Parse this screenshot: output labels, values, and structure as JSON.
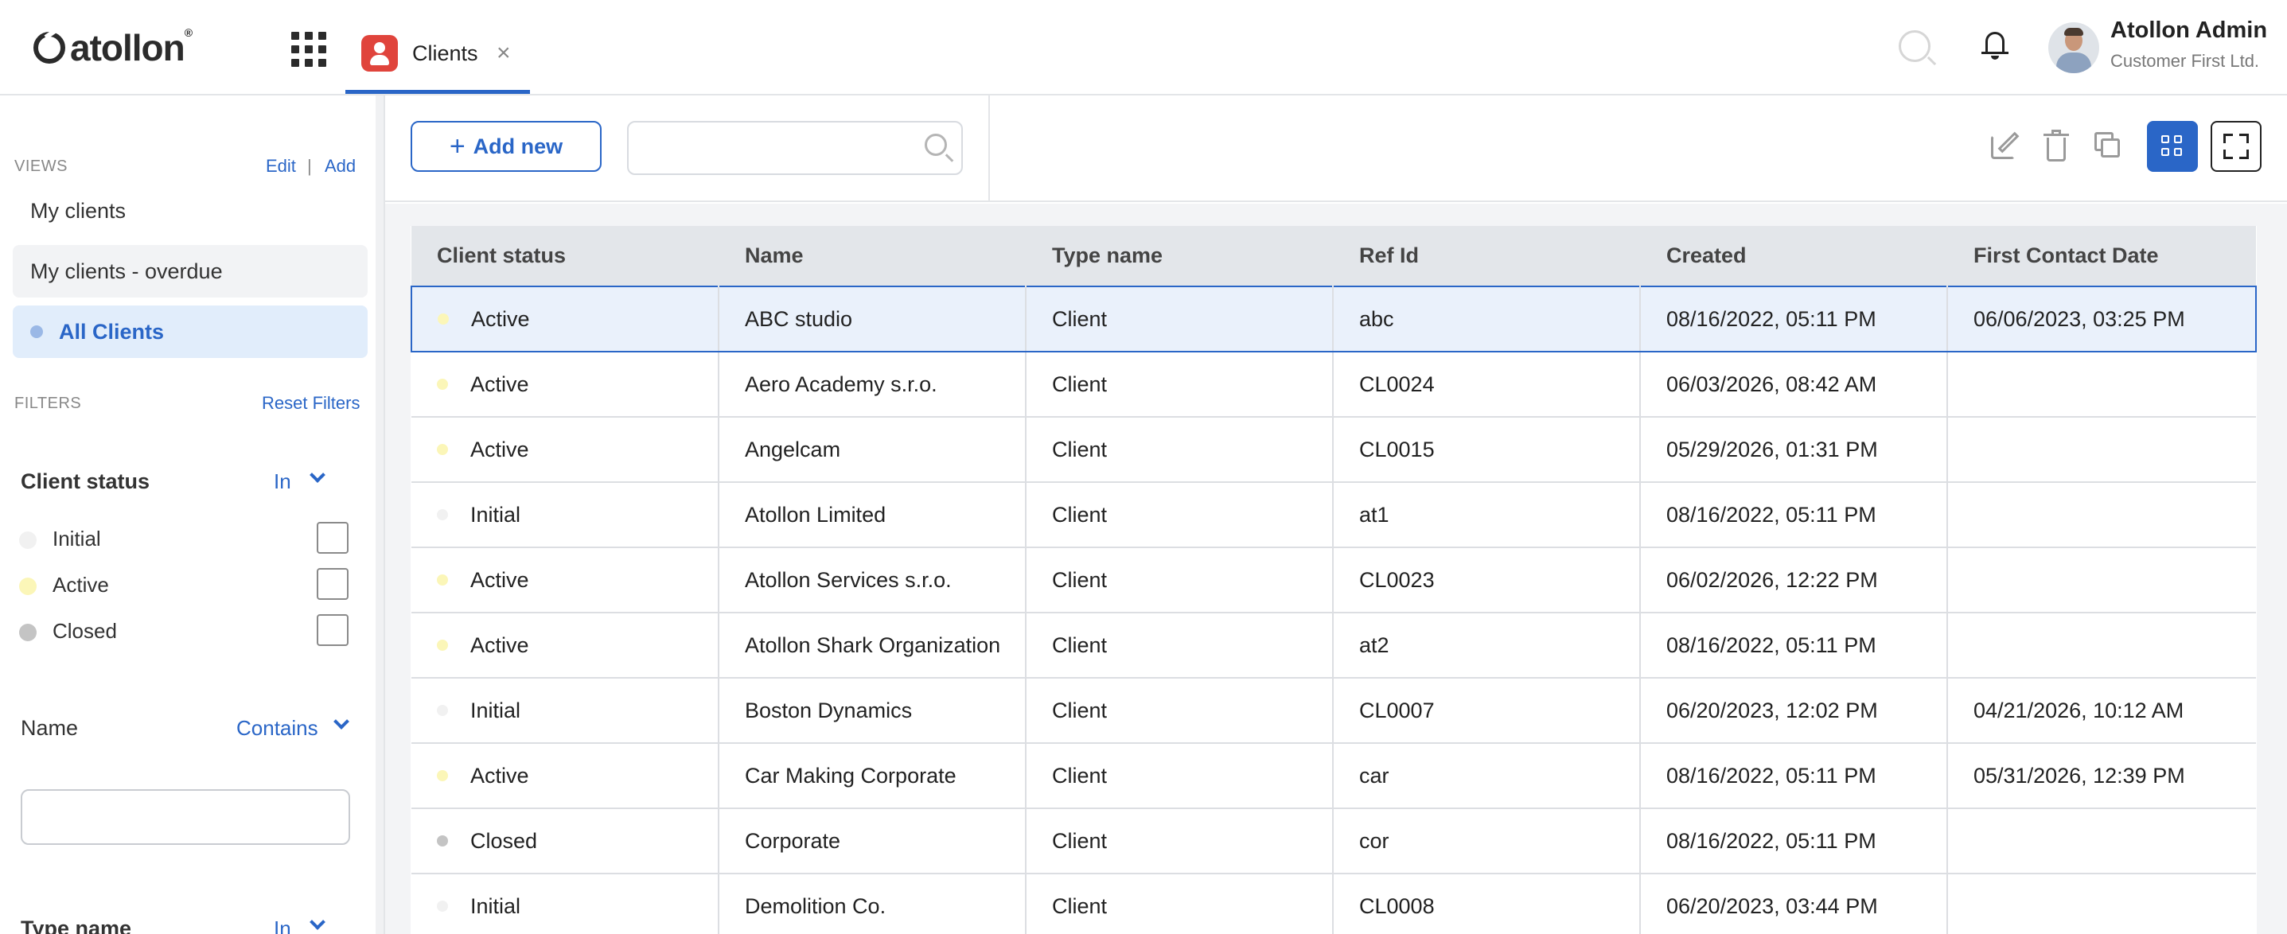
{
  "header": {
    "logo_text": "atollon",
    "logo_reg": "®",
    "tab_label": "Clients",
    "tab_close": "×",
    "user_name": "Atollon Admin",
    "user_org": "Customer First Ltd."
  },
  "sidebar": {
    "views_label": "VIEWS",
    "edit_label": "Edit",
    "sep": "|",
    "add_label": "Add",
    "views": [
      {
        "label": "My clients"
      },
      {
        "label": "My clients - overdue"
      },
      {
        "label": "All Clients"
      }
    ],
    "filters_label": "FILTERS",
    "reset_label": "Reset Filters",
    "client_status": {
      "title": "Client status",
      "operator": "In",
      "options": [
        {
          "label": "Initial",
          "color": "#f1f1f1",
          "checked": false
        },
        {
          "label": "Active",
          "color": "#fbf6b8",
          "checked": false
        },
        {
          "label": "Closed",
          "color": "#c4c4c4",
          "checked": false
        }
      ]
    },
    "name_filter": {
      "title": "Name",
      "operator": "Contains",
      "value": ""
    },
    "type_filter": {
      "title": "Type name",
      "operator": "In"
    }
  },
  "toolbar": {
    "add_plus": "+",
    "add_label": "Add new",
    "search_value": ""
  },
  "table": {
    "columns": [
      "Client status",
      "Name",
      "Type name",
      "Ref Id",
      "Created",
      "First Contact Date"
    ],
    "rows": [
      {
        "status": "Active",
        "name": "ABC studio",
        "type": "Client",
        "ref": "abc",
        "created": "08/16/2022, 05:11 PM",
        "first_contact": "06/06/2023, 03:25 PM",
        "selected": true
      },
      {
        "status": "Active",
        "name": "Aero Academy s.r.o.",
        "type": "Client",
        "ref": "CL0024",
        "created": "06/03/2026, 08:42 AM",
        "first_contact": ""
      },
      {
        "status": "Active",
        "name": "Angelcam",
        "type": "Client",
        "ref": "CL0015",
        "created": "05/29/2026, 01:31 PM",
        "first_contact": ""
      },
      {
        "status": "Initial",
        "name": "Atollon Limited",
        "type": "Client",
        "ref": "at1",
        "created": "08/16/2022, 05:11 PM",
        "first_contact": ""
      },
      {
        "status": "Active",
        "name": "Atollon Services s.r.o.",
        "type": "Client",
        "ref": "CL0023",
        "created": "06/02/2026, 12:22 PM",
        "first_contact": ""
      },
      {
        "status": "Active",
        "name": "Atollon Shark Organization",
        "type": "Client",
        "ref": "at2",
        "created": "08/16/2022, 05:11 PM",
        "first_contact": ""
      },
      {
        "status": "Initial",
        "name": "Boston Dynamics",
        "type": "Client",
        "ref": "CL0007",
        "created": "06/20/2023, 12:02 PM",
        "first_contact": "04/21/2026, 10:12 AM"
      },
      {
        "status": "Active",
        "name": "Car Making Corporate",
        "type": "Client",
        "ref": "car",
        "created": "08/16/2022, 05:11 PM",
        "first_contact": "05/31/2026, 12:39 PM"
      },
      {
        "status": "Closed",
        "name": "Corporate",
        "type": "Client",
        "ref": "cor",
        "created": "08/16/2022, 05:11 PM",
        "first_contact": ""
      },
      {
        "status": "Initial",
        "name": "Demolition Co.",
        "type": "Client",
        "ref": "CL0008",
        "created": "06/20/2023, 03:44 PM",
        "first_contact": ""
      }
    ]
  },
  "colors": {
    "accent": "#2a66c7",
    "status_initial": "#f1f1f1",
    "status_active": "#fbf6b8",
    "status_closed": "#c4c4c4"
  }
}
